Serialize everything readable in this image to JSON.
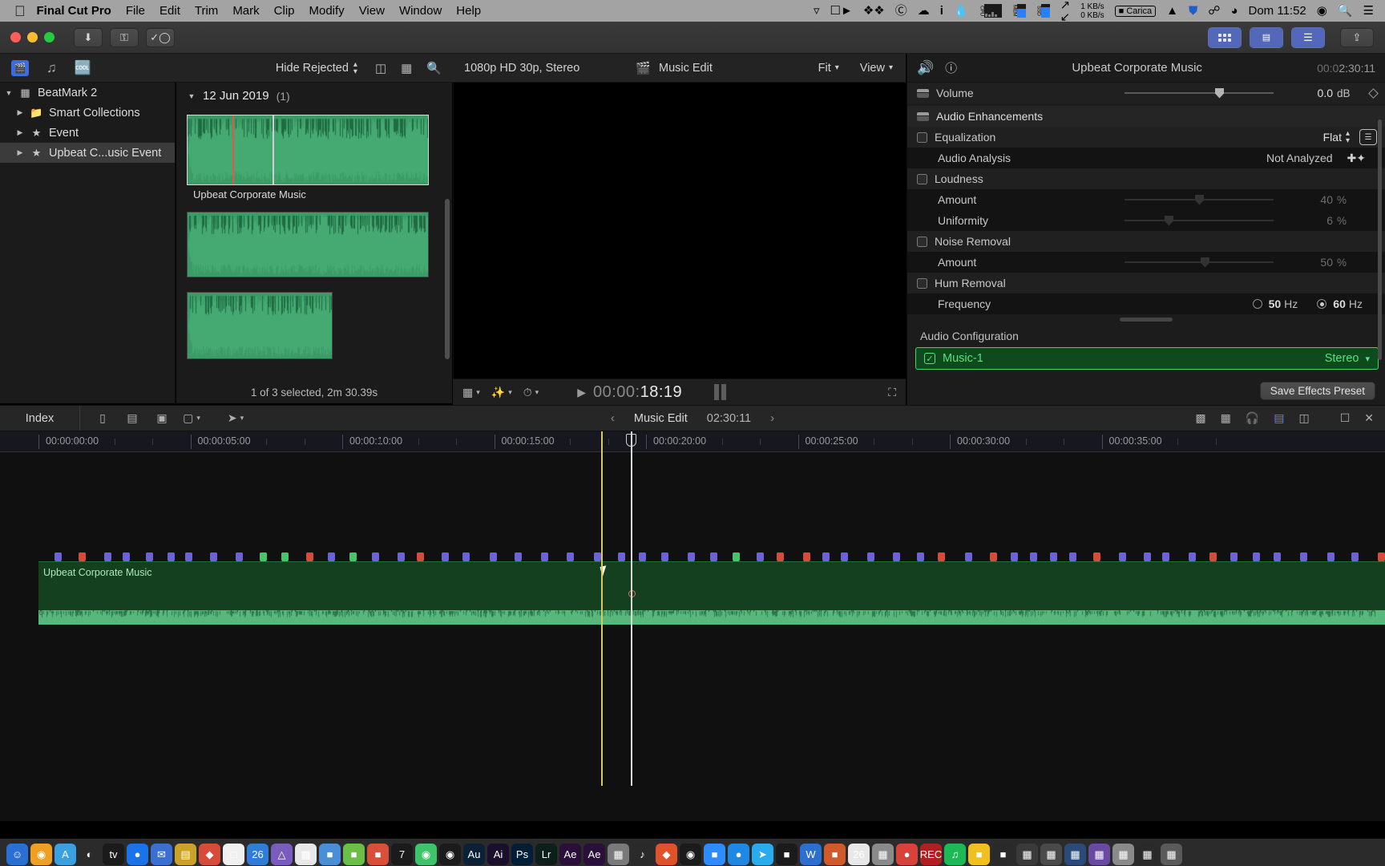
{
  "menubar": {
    "apple_icon": "apple-logo",
    "app": "Final Cut Pro",
    "items": [
      "File",
      "Edit",
      "Trim",
      "Mark",
      "Clip",
      "Modify",
      "View",
      "Window",
      "Help"
    ],
    "net_up": "1 KB/s",
    "net_down": "0 KB/s",
    "carica": "Carica",
    "clock": "Dom 11:52",
    "status_icons": [
      "screenshot-icon",
      "facetime-icon",
      "dropbox-icon",
      "creative-cloud-icon",
      "onedrive-icon",
      "info-icon",
      "flame-icon",
      "cpu-meter-icon",
      "memory-icon",
      "ssd-icon",
      "network-arrows-icon",
      "battery-icon",
      "bluetooth-icon",
      "wifi-icon",
      "siri-icon",
      "search-icon",
      "control-center-icon"
    ],
    "labels": {
      "cpu": "CPU",
      "mem": "MEM",
      "ssd": "SSD"
    }
  },
  "toolbar": {
    "import_icon": "import-arrow-icon",
    "keyword_icon": "keyword-key-icon",
    "rate_icon": "rate-check-icon",
    "share_icon": "share-icon",
    "view_buttons": [
      "browser-grid-icon",
      "viewer-layout-icon",
      "inspector-icon"
    ]
  },
  "browser_bar": {
    "library_icon": "library-clapper-icon",
    "music_icon": "music-note-icon",
    "titles_icon": "titles-text-icon",
    "filter_label": "Hide Rejected",
    "list_icon": "list-view-icon",
    "filmstrip_icon": "filmstrip-view-icon",
    "search_icon": "search-icon"
  },
  "sidebar": {
    "items": [
      {
        "label": "BeatMark 2",
        "icon": "library-grid-icon",
        "level": 0,
        "expanded": true,
        "selected": false
      },
      {
        "label": "Smart Collections",
        "icon": "folder-icon",
        "level": 1,
        "expanded": false,
        "selected": false
      },
      {
        "label": "Event",
        "icon": "event-star-icon",
        "level": 1,
        "expanded": false,
        "selected": false
      },
      {
        "label": "Upbeat C...usic Event",
        "icon": "event-star-icon",
        "level": 1,
        "expanded": false,
        "selected": true
      }
    ]
  },
  "browser": {
    "date_header": "12 Jun 2019",
    "count": "(1)",
    "clip_label": "Upbeat Corporate Music",
    "status": "1 of 3 selected, 2m 30.39s"
  },
  "viewer": {
    "format": "1080p HD 30p, Stereo",
    "project_icon": "project-clapper-icon",
    "project_name": "Music Edit",
    "fit_label": "Fit",
    "view_label": "View",
    "timecode": "00:00:18:19",
    "tc_dim_part": "00:00:",
    "tc_bright_part": "18:19",
    "play_icon": "play-icon",
    "transport_icons": [
      "clip-appearance-icon",
      "effects-wand-icon",
      "speed-gauge-icon"
    ],
    "fullscreen_icon": "fullscreen-icon"
  },
  "inspector": {
    "volume_icon": "audio-speaker-icon",
    "info_icon": "info-circle-icon",
    "title": "Upbeat Corporate Music",
    "duration": "00:02:30:11",
    "duration_dim": "00:0",
    "duration_bright": "2:30:11",
    "rows": [
      {
        "name": "Volume",
        "kind": "slider-grip",
        "value": "0.0",
        "unit": "dB",
        "slider": 62,
        "dimmed": false,
        "keyframe": true
      },
      {
        "name": "Audio Enhancements",
        "kind": "header-grip"
      },
      {
        "name": "Equalization",
        "kind": "checkbox",
        "value": "Flat",
        "unit": "",
        "popup": true,
        "eq_button": true
      },
      {
        "name": "Audio Analysis",
        "kind": "indent",
        "value": "Not Analyzed",
        "unit": "",
        "magic": true
      },
      {
        "name": "Loudness",
        "kind": "checkbox"
      },
      {
        "name": "Amount",
        "kind": "indent-slider",
        "value": "40",
        "unit": "%",
        "slider": 48,
        "dimmed": true
      },
      {
        "name": "Uniformity",
        "kind": "indent-slider",
        "value": "6",
        "unit": "%",
        "slider": 27,
        "dimmed": true
      },
      {
        "name": "Noise Removal",
        "kind": "checkbox"
      },
      {
        "name": "Amount",
        "kind": "indent-slider",
        "value": "50",
        "unit": "%",
        "slider": 51,
        "dimmed": true
      },
      {
        "name": "Hum Removal",
        "kind": "checkbox"
      },
      {
        "name": "Frequency",
        "kind": "radios",
        "opt1": "50",
        "opt1_unit": "Hz",
        "opt2": "60",
        "opt2_unit": "Hz",
        "selected": 2
      }
    ],
    "audio_config_title": "Audio Configuration",
    "music_channel": "Music-1",
    "channel_mode": "Stereo",
    "save_preset": "Save Effects Preset",
    "accent_green": "#58e27c"
  },
  "timeline": {
    "index_label": "Index",
    "project_name": "Music Edit",
    "project_duration": "02:30:11",
    "prev_icon": "chevron-left-icon",
    "next_icon": "chevron-right-icon",
    "tool_icons": [
      "append-icon",
      "insert-icon",
      "overwrite-icon",
      "connect-icon"
    ],
    "select_tool_icon": "arrow-select-icon",
    "right_icons": [
      "audio-meters-icon",
      "mixer-icon",
      "headphones-icon",
      "index-icon",
      "timeline-index-icon",
      "clip-height-icon",
      "close-panel-icon"
    ],
    "ruler_labels": [
      "00:00:00:00",
      "00:00:05:00",
      "00:00:10:00",
      "00:00:15:00",
      "00:00:20:00",
      "00:00:25:00",
      "00:00:30:00",
      "00:00:35:00"
    ],
    "clip_name": "Upbeat Corporate Music",
    "playhead_tc": "00:00:18:19"
  },
  "colors": {
    "menubar_bg": "#a3a3a3",
    "panel_bg": "#1c1c1c",
    "clip_green": "#14401f",
    "wave_green": "#58b87c",
    "marker_blue": "#6a64d8",
    "marker_red": "#d84a3a",
    "marker_green": "#4ac46a",
    "playhead_yellow": "#d8c86a",
    "selection_green": "#58e27c",
    "accent_blue": "#3c6de0"
  }
}
